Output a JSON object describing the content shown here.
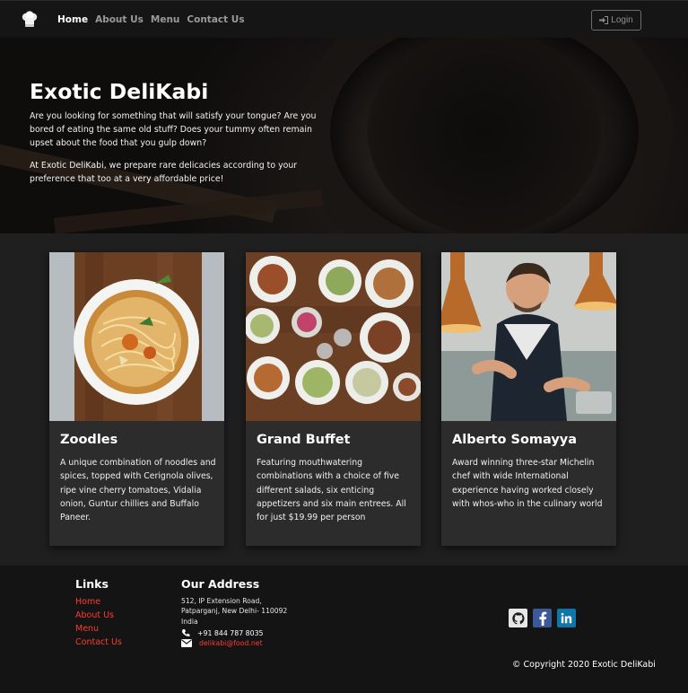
{
  "nav": {
    "brand_icon": "chef-hat-icon",
    "links": [
      {
        "label": "Home",
        "active": true
      },
      {
        "label": "About Us",
        "active": false
      },
      {
        "label": "Menu",
        "active": false
      },
      {
        "label": "Contact Us",
        "active": false
      }
    ],
    "login_label": "Login"
  },
  "jumbotron": {
    "title": "Exotic DeliKabi",
    "p1": "Are you looking for something that will satisfy your tongue? Are you bored of eating the same old stuff? Does your tummy often remain upset about the food that you gulp down?",
    "p2": "At Exotic DeliKabi, we prepare rare delicacies according to your preference that too at a very affordable price!"
  },
  "cards": [
    {
      "title": "Zoodles",
      "text": "A unique combination of noodles and spices, topped with Cerignola olives, ripe vine cherry tomatoes, Vidalia onion, Guntur chillies and Buffalo Paneer."
    },
    {
      "title": "Grand Buffet",
      "text": "Featuring mouthwatering combinations with a choice of five different salads, six enticing appetizers and six main entrees. All for just $19.99 per person"
    },
    {
      "title": "Alberto Somayya",
      "text": "Award winning three-star Michelin chef with wide International experience having worked closely with whos-who in the culinary world"
    }
  ],
  "footer": {
    "links_heading": "Links",
    "links": [
      "Home",
      "About Us",
      "Menu",
      "Contact Us"
    ],
    "address_heading": "Our Address",
    "address_line1": "512, IP Extension Road,",
    "address_line2": "Patparganj, New Delhi- 110092",
    "address_line3": "India",
    "phone": "+91 844 787 8035",
    "email": "delikabi@food.net",
    "socials": [
      "github-icon",
      "facebook-icon",
      "linkedin-icon"
    ],
    "copyright": "© Copyright 2020 Exotic DeliKabi"
  },
  "colors": {
    "accent_link": "#ff3b2f",
    "facebook": "#3b5998",
    "linkedin": "#0e76a8"
  }
}
